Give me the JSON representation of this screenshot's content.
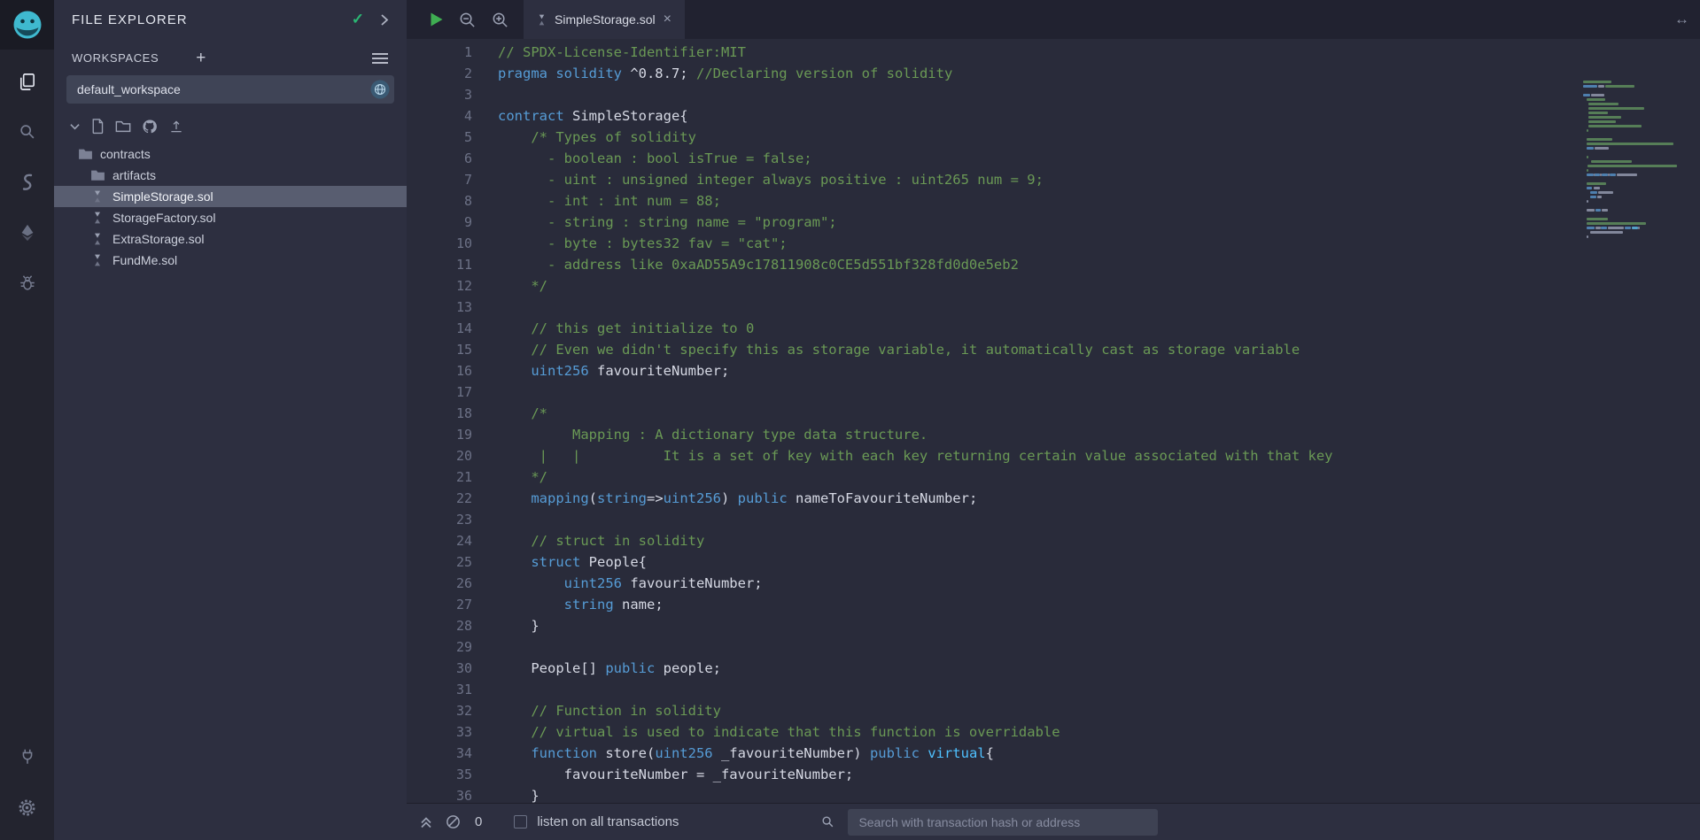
{
  "colors": {
    "accent": "#3fb9cf",
    "keyword": "#569cd6",
    "keyword_light": "#4fc1ff",
    "comment": "#6a9955",
    "text": "#d6d9e4",
    "check_green": "#2bb673",
    "play_green": "#3fae52",
    "selected_row": "#585d70"
  },
  "icons": {
    "check": "✓",
    "plus": "+",
    "close": "×",
    "resize_h": "↔"
  },
  "file_explorer": {
    "title": "FILE EXPLORER",
    "workspaces_label": "WORKSPACES",
    "workspace_selected": "default_workspace",
    "tree": [
      {
        "label": "contracts",
        "type": "folder",
        "depth": 0,
        "selected": false
      },
      {
        "label": "artifacts",
        "type": "folder",
        "depth": 1,
        "selected": false
      },
      {
        "label": "SimpleStorage.sol",
        "type": "sol",
        "depth": 1,
        "selected": true
      },
      {
        "label": "StorageFactory.sol",
        "type": "sol",
        "depth": 1,
        "selected": false
      },
      {
        "label": "ExtraStorage.sol",
        "type": "sol",
        "depth": 1,
        "selected": false
      },
      {
        "label": "FundMe.sol",
        "type": "sol",
        "depth": 1,
        "selected": false
      }
    ]
  },
  "editor": {
    "tab": "SimpleStorage.sol",
    "lines": [
      {
        "n": 1,
        "segs": [
          [
            "c",
            "// SPDX-License-Identifier:MIT"
          ]
        ]
      },
      {
        "n": 2,
        "segs": [
          [
            "k",
            "pragma solidity"
          ],
          [
            "p",
            " ^0.8.7; "
          ],
          [
            "c",
            "//Declaring version of solidity"
          ]
        ]
      },
      {
        "n": 3,
        "segs": []
      },
      {
        "n": 4,
        "segs": [
          [
            "k",
            "contract"
          ],
          [
            "p",
            " SimpleStorage{"
          ]
        ]
      },
      {
        "n": 5,
        "segs": [
          [
            "c",
            "    /* Types of solidity"
          ]
        ]
      },
      {
        "n": 6,
        "segs": [
          [
            "c",
            "      - boolean : bool isTrue = false;"
          ]
        ]
      },
      {
        "n": 7,
        "segs": [
          [
            "c",
            "      - uint : unsigned integer always positive : uint265 num = 9;"
          ]
        ]
      },
      {
        "n": 8,
        "segs": [
          [
            "c",
            "      - int : int num = 88;"
          ]
        ]
      },
      {
        "n": 9,
        "segs": [
          [
            "c",
            "      - string : string name = \"program\";"
          ]
        ]
      },
      {
        "n": 10,
        "segs": [
          [
            "c",
            "      - byte : bytes32 fav = \"cat\";"
          ]
        ]
      },
      {
        "n": 11,
        "segs": [
          [
            "c",
            "      - address like 0xaAD55A9c17811908c0CE5d551bf328fd0d0e5eb2"
          ]
        ]
      },
      {
        "n": 12,
        "segs": [
          [
            "c",
            "    */"
          ]
        ]
      },
      {
        "n": 13,
        "segs": []
      },
      {
        "n": 14,
        "segs": [
          [
            "c",
            "    // this get initialize to 0"
          ]
        ]
      },
      {
        "n": 15,
        "segs": [
          [
            "c",
            "    // Even we didn't specify this as storage variable, it automatically cast as storage variable"
          ]
        ]
      },
      {
        "n": 16,
        "segs": [
          [
            "p",
            "    "
          ],
          [
            "k",
            "uint256"
          ],
          [
            "p",
            " favouriteNumber;"
          ]
        ]
      },
      {
        "n": 17,
        "segs": []
      },
      {
        "n": 18,
        "segs": [
          [
            "c",
            "    /*"
          ]
        ]
      },
      {
        "n": 19,
        "segs": [
          [
            "c",
            "         Mapping : A dictionary type data structure."
          ]
        ]
      },
      {
        "n": 20,
        "segs": [
          [
            "c",
            "     |   |          It is a set of key with each key returning certain value associated with that key"
          ]
        ]
      },
      {
        "n": 21,
        "segs": [
          [
            "c",
            "    */"
          ]
        ]
      },
      {
        "n": 22,
        "segs": [
          [
            "p",
            "    "
          ],
          [
            "k",
            "mapping"
          ],
          [
            "p",
            "("
          ],
          [
            "k",
            "string"
          ],
          [
            "p",
            "=>"
          ],
          [
            "k",
            "uint256"
          ],
          [
            "p",
            ") "
          ],
          [
            "k",
            "public"
          ],
          [
            "p",
            " nameToFavouriteNumber;"
          ]
        ]
      },
      {
        "n": 23,
        "segs": []
      },
      {
        "n": 24,
        "segs": [
          [
            "c",
            "    // struct in solidity"
          ]
        ]
      },
      {
        "n": 25,
        "segs": [
          [
            "p",
            "    "
          ],
          [
            "k",
            "struct"
          ],
          [
            "p",
            " People{"
          ]
        ]
      },
      {
        "n": 26,
        "segs": [
          [
            "p",
            "        "
          ],
          [
            "k",
            "uint256"
          ],
          [
            "p",
            " favouriteNumber;"
          ]
        ]
      },
      {
        "n": 27,
        "segs": [
          [
            "p",
            "        "
          ],
          [
            "k",
            "string"
          ],
          [
            "p",
            " name;"
          ]
        ]
      },
      {
        "n": 28,
        "segs": [
          [
            "p",
            "    }"
          ]
        ]
      },
      {
        "n": 29,
        "segs": []
      },
      {
        "n": 30,
        "segs": [
          [
            "p",
            "    People[] "
          ],
          [
            "k",
            "public"
          ],
          [
            "p",
            " people;"
          ]
        ]
      },
      {
        "n": 31,
        "segs": []
      },
      {
        "n": 32,
        "segs": [
          [
            "c",
            "    // Function in solidity"
          ]
        ]
      },
      {
        "n": 33,
        "segs": [
          [
            "c",
            "    // virtual is used to indicate that this function is overridable"
          ]
        ]
      },
      {
        "n": 34,
        "segs": [
          [
            "p",
            "    "
          ],
          [
            "k",
            "function"
          ],
          [
            "p",
            " store("
          ],
          [
            "k",
            "uint256"
          ],
          [
            "p",
            " _favouriteNumber) "
          ],
          [
            "k",
            "public"
          ],
          [
            "p",
            " "
          ],
          [
            "k2",
            "virtual"
          ],
          [
            "p",
            "{"
          ]
        ]
      },
      {
        "n": 35,
        "segs": [
          [
            "p",
            "        favouriteNumber = _favouriteNumber;"
          ]
        ]
      },
      {
        "n": 36,
        "segs": [
          [
            "p",
            "    }"
          ]
        ]
      }
    ]
  },
  "terminal": {
    "count": "0",
    "listen_label": "listen on all transactions",
    "search_placeholder": "Search with transaction hash or address"
  }
}
